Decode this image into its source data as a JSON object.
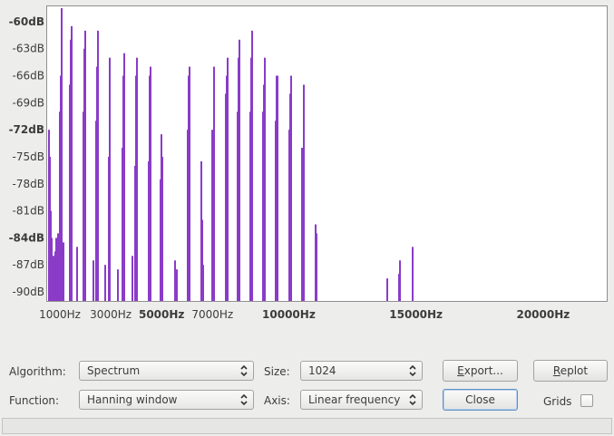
{
  "chart_data": {
    "type": "bar",
    "xlabel": "",
    "ylabel": "",
    "x_range_hz": [
      500,
      22500
    ],
    "y_range_db": [
      -91,
      -58.3
    ],
    "y_ticks": [
      {
        "label": "-60dB",
        "value": -60,
        "bold": true
      },
      {
        "label": "-63dB",
        "value": -63,
        "bold": false
      },
      {
        "label": "-66dB",
        "value": -66,
        "bold": false
      },
      {
        "label": "-69dB",
        "value": -69,
        "bold": false
      },
      {
        "label": "-72dB",
        "value": -72,
        "bold": true
      },
      {
        "label": "-75dB",
        "value": -75,
        "bold": false
      },
      {
        "label": "-78dB",
        "value": -78,
        "bold": false
      },
      {
        "label": "-81dB",
        "value": -81,
        "bold": false
      },
      {
        "label": "-84dB",
        "value": -84,
        "bold": true
      },
      {
        "label": "-87dB",
        "value": -87,
        "bold": false
      },
      {
        "label": "-90dB",
        "value": -90,
        "bold": false
      }
    ],
    "x_ticks": [
      {
        "label": "1000Hz",
        "value": 1000,
        "bold": false
      },
      {
        "label": "3000Hz",
        "value": 3000,
        "bold": false
      },
      {
        "label": "5000Hz",
        "value": 5000,
        "bold": true
      },
      {
        "label": "7000Hz",
        "value": 7000,
        "bold": false
      },
      {
        "label": "10000Hz",
        "value": 10000,
        "bold": true
      },
      {
        "label": "15000Hz",
        "value": 15000,
        "bold": true
      },
      {
        "label": "20000Hz",
        "value": 20000,
        "bold": true
      }
    ],
    "bar_color": "#8a3cc8",
    "peaks": [
      {
        "x": 520,
        "db": -72
      },
      {
        "x": 560,
        "db": -75
      },
      {
        "x": 600,
        "db": -81
      },
      {
        "x": 650,
        "db": -84
      },
      {
        "x": 700,
        "db": -86
      },
      {
        "x": 760,
        "db": -87
      },
      {
        "x": 830,
        "db": -84
      },
      {
        "x": 900,
        "db": -83.5
      },
      {
        "x": 980,
        "db": -70
      },
      {
        "x": 1010,
        "db": -66
      },
      {
        "x": 1040,
        "db": -58.5
      },
      {
        "x": 1080,
        "db": -85
      },
      {
        "x": 1120,
        "db": -84.5
      },
      {
        "x": 1350,
        "db": -67
      },
      {
        "x": 1390,
        "db": -62
      },
      {
        "x": 1430,
        "db": -60.5
      },
      {
        "x": 1650,
        "db": -85
      },
      {
        "x": 1880,
        "db": -70
      },
      {
        "x": 1920,
        "db": -63
      },
      {
        "x": 1960,
        "db": -61
      },
      {
        "x": 2280,
        "db": -86.5
      },
      {
        "x": 2390,
        "db": -71
      },
      {
        "x": 2430,
        "db": -65
      },
      {
        "x": 2460,
        "db": -61
      },
      {
        "x": 2740,
        "db": -87
      },
      {
        "x": 2880,
        "db": -75
      },
      {
        "x": 2910,
        "db": -68
      },
      {
        "x": 2940,
        "db": -64
      },
      {
        "x": 3230,
        "db": -87.5
      },
      {
        "x": 3420,
        "db": -74
      },
      {
        "x": 3460,
        "db": -66
      },
      {
        "x": 3490,
        "db": -63.5
      },
      {
        "x": 3820,
        "db": -86
      },
      {
        "x": 3930,
        "db": -76
      },
      {
        "x": 3970,
        "db": -66
      },
      {
        "x": 4000,
        "db": -64
      },
      {
        "x": 4470,
        "db": -75.5
      },
      {
        "x": 4510,
        "db": -66
      },
      {
        "x": 4540,
        "db": -65
      },
      {
        "x": 4930,
        "db": -77.5
      },
      {
        "x": 4970,
        "db": -72.5
      },
      {
        "x": 4990,
        "db": -75
      },
      {
        "x": 5490,
        "db": -86.5
      },
      {
        "x": 5560,
        "db": -87.5
      },
      {
        "x": 5980,
        "db": -72
      },
      {
        "x": 6030,
        "db": -66
      },
      {
        "x": 6060,
        "db": -65
      },
      {
        "x": 6510,
        "db": -75.5
      },
      {
        "x": 6560,
        "db": -82
      },
      {
        "x": 6590,
        "db": -87
      },
      {
        "x": 6960,
        "db": -72
      },
      {
        "x": 7010,
        "db": -66
      },
      {
        "x": 7040,
        "db": -65
      },
      {
        "x": 7500,
        "db": -68
      },
      {
        "x": 7540,
        "db": -66
      },
      {
        "x": 7570,
        "db": -64
      },
      {
        "x": 7950,
        "db": -70
      },
      {
        "x": 8000,
        "db": -64
      },
      {
        "x": 8030,
        "db": -62
      },
      {
        "x": 8440,
        "db": -70
      },
      {
        "x": 8490,
        "db": -64
      },
      {
        "x": 8520,
        "db": -61
      },
      {
        "x": 8950,
        "db": -70
      },
      {
        "x": 8990,
        "db": -67
      },
      {
        "x": 9020,
        "db": -64
      },
      {
        "x": 9460,
        "db": -71
      },
      {
        "x": 9500,
        "db": -66
      },
      {
        "x": 9530,
        "db": -66
      },
      {
        "x": 9970,
        "db": -72
      },
      {
        "x": 10010,
        "db": -68
      },
      {
        "x": 10040,
        "db": -66
      },
      {
        "x": 10500,
        "db": -74
      },
      {
        "x": 10540,
        "db": -70
      },
      {
        "x": 10570,
        "db": -67
      },
      {
        "x": 11030,
        "db": -82.5
      },
      {
        "x": 11060,
        "db": -83.5
      },
      {
        "x": 13820,
        "db": -88.5
      },
      {
        "x": 14300,
        "db": -88
      },
      {
        "x": 14330,
        "db": -86.5
      },
      {
        "x": 14840,
        "db": -85
      }
    ],
    "noise_floor": [
      {
        "x": 540,
        "db": -84
      },
      {
        "x": 580,
        "db": -86
      },
      {
        "x": 620,
        "db": -85
      },
      {
        "x": 680,
        "db": -86.5
      },
      {
        "x": 740,
        "db": -86
      },
      {
        "x": 800,
        "db": -85.5
      },
      {
        "x": 860,
        "db": -86
      },
      {
        "x": 940,
        "db": -85
      }
    ]
  },
  "controls": {
    "algorithm": {
      "label": "Algorithm:",
      "value": "Spectrum"
    },
    "function": {
      "label": "Function:",
      "value": "Hanning window"
    },
    "size": {
      "label": "Size:",
      "value": "1024"
    },
    "axis": {
      "label": "Axis:",
      "value": "Linear frequency"
    },
    "export_button": {
      "mnemonic": "E",
      "rest": "xport..."
    },
    "replot_button": {
      "mnemonic": "R",
      "rest": "eplot"
    },
    "close_button": {
      "label": "Close"
    },
    "grids": {
      "label": "Grids",
      "checked": false
    }
  }
}
